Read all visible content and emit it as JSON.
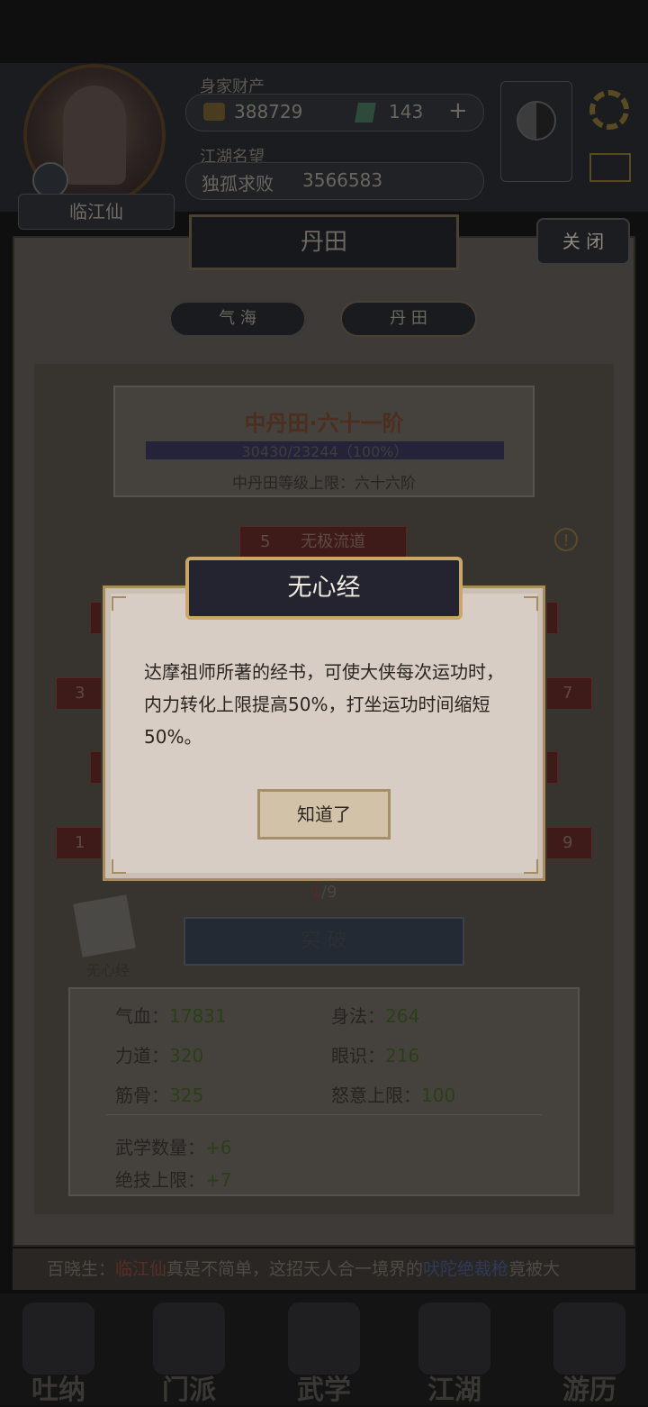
{
  "hud": {
    "wealth_label": "身家财产",
    "coins": "388729",
    "gems": "143",
    "add_symbol": "+",
    "reputation_label": "江湖名望",
    "title": "独孤求败",
    "reputation_value": "3566583",
    "player_name": "临江仙"
  },
  "panel": {
    "title": "丹田",
    "close_label": "关 闭",
    "tabs": [
      "气 海",
      "丹 田"
    ]
  },
  "dantian": {
    "title": "中丹田·六十一阶",
    "progress_text": "30430/23244（100%）",
    "progress": 1.0,
    "limit_text": "中丹田等级上限：六十六阶"
  },
  "nodes": {
    "top_node_number": "5",
    "top_node_name": "无极流道",
    "left_mid_number": "3",
    "right_mid_number": "7",
    "left_low_number": "1",
    "right_low_number": "9",
    "warning_symbol": "!"
  },
  "page_current": "1",
  "page_total": "/9",
  "breakthrough_label": "突 破",
  "book_label": "无心经",
  "stats": {
    "rows": [
      {
        "k1": "气血：",
        "v1": "17831",
        "k2": "身法：",
        "v2": "264"
      },
      {
        "k1": "力道：",
        "v1": "320",
        "k2": "眼识：",
        "v2": "216"
      },
      {
        "k1": "筋骨：",
        "v1": "325",
        "k2": "怒意上限：",
        "v2": "100"
      }
    ],
    "martial_count_label": "武学数量：",
    "martial_count_value": "+6",
    "skill_cap_label": "绝技上限：",
    "skill_cap_value": "+7"
  },
  "ticker": {
    "prefix": "百晓生：",
    "name": "临江仙",
    "middle": "真是不简单，这招天人合一境界的",
    "skill": "吠陀绝裁枪",
    "suffix": "竟被大"
  },
  "bottom_nav": [
    "吐纳",
    "门派",
    "武学",
    "江湖",
    "游历"
  ],
  "modal": {
    "title": "无心经",
    "body": "达摩祖师所著的经书，可使大侠每次运功时，内力转化上限提高50%，打坐运功时间缩短50%。",
    "ok_label": "知道了"
  },
  "colors": {
    "modal_bg": "#d7cdc4",
    "modal_border": "#a78c5e",
    "title_plate": "#232430",
    "gold_trim": "#c8a769"
  }
}
